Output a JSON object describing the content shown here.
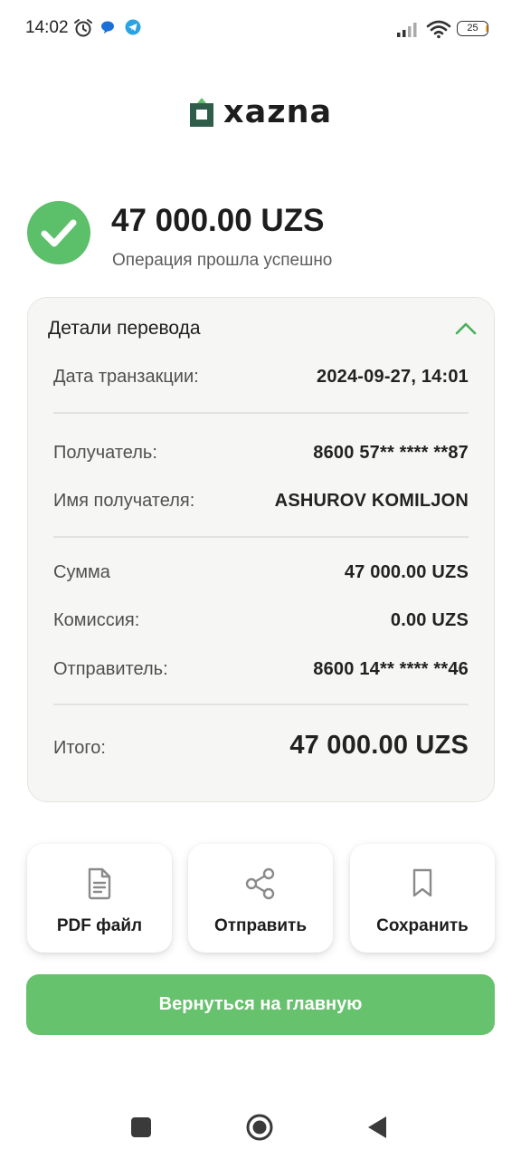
{
  "status_bar": {
    "time": "14:02",
    "battery": "25"
  },
  "brand": {
    "logo_text": "xazna",
    "accent": "#2f5d49"
  },
  "result": {
    "amount": "47 000.00 UZS",
    "status_text": "Операция прошла успешно",
    "success_color": "#5cbf69"
  },
  "details": {
    "title": "Детали перевода",
    "transaction_date_label": "Дата транзакции:",
    "transaction_date_value": "2024-09-27, 14:01",
    "recipient_label": "Получатель:",
    "recipient_value": "8600 57** **** **87",
    "recipient_name_label": "Имя получателя:",
    "recipient_name_value": "ASHUROV KOMILJON",
    "sum_label": "Сумма",
    "sum_value": "47 000.00 UZS",
    "fee_label": "Комиссия:",
    "fee_value": "0.00 UZS",
    "sender_label": "Отправитель:",
    "sender_value": "8600 14** **** **46",
    "total_label": "Итого:",
    "total_value": "47 000.00 UZS"
  },
  "actions": {
    "pdf_label": "PDF файл",
    "send_label": "Отправить",
    "save_label": "Сохранить"
  },
  "primary_button": {
    "label": "Вернуться на главную",
    "color": "#66c26c"
  },
  "icons": {
    "pdf": "document-icon",
    "send": "share-icon",
    "save": "bookmark-icon"
  }
}
